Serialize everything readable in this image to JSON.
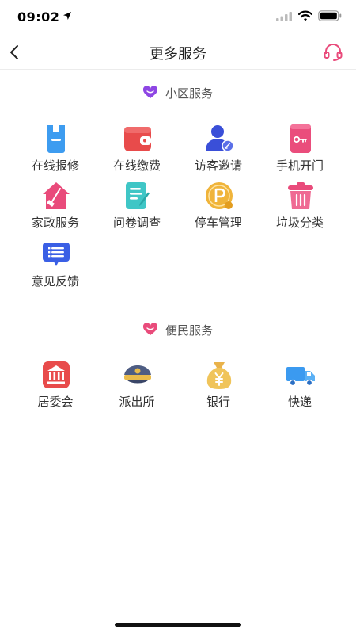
{
  "status_bar": {
    "time": "09:02",
    "icons": [
      "location-arrow-icon",
      "cellular-signal-icon",
      "wifi-icon",
      "battery-icon"
    ]
  },
  "nav": {
    "title": "更多服务",
    "back_icon": "chevron-left-icon",
    "service_icon": "headset-icon",
    "accent_color": "#e94b7b"
  },
  "sections": [
    {
      "title": "小区服务",
      "heart_color": "#8e46e4",
      "items": [
        {
          "label": "在线报修",
          "icon": "repair-wrench-icon"
        },
        {
          "label": "在线缴费",
          "icon": "wallet-icon"
        },
        {
          "label": "访客邀请",
          "icon": "visitor-user-icon"
        },
        {
          "label": "手机开门",
          "icon": "phone-key-icon"
        },
        {
          "label": "家政服务",
          "icon": "house-broom-icon"
        },
        {
          "label": "问卷调查",
          "icon": "questionnaire-icon"
        },
        {
          "label": "停车管理",
          "icon": "parking-coin-icon"
        },
        {
          "label": "垃圾分类",
          "icon": "trash-bin-icon"
        },
        {
          "label": "意见反馈",
          "icon": "feedback-message-icon"
        }
      ]
    },
    {
      "title": "便民服务",
      "heart_color": "#e94b7b",
      "items": [
        {
          "label": "居委会",
          "icon": "committee-building-icon"
        },
        {
          "label": "派出所",
          "icon": "police-cap-icon"
        },
        {
          "label": "银行",
          "icon": "money-bag-icon"
        },
        {
          "label": "快递",
          "icon": "delivery-truck-icon"
        }
      ]
    }
  ]
}
